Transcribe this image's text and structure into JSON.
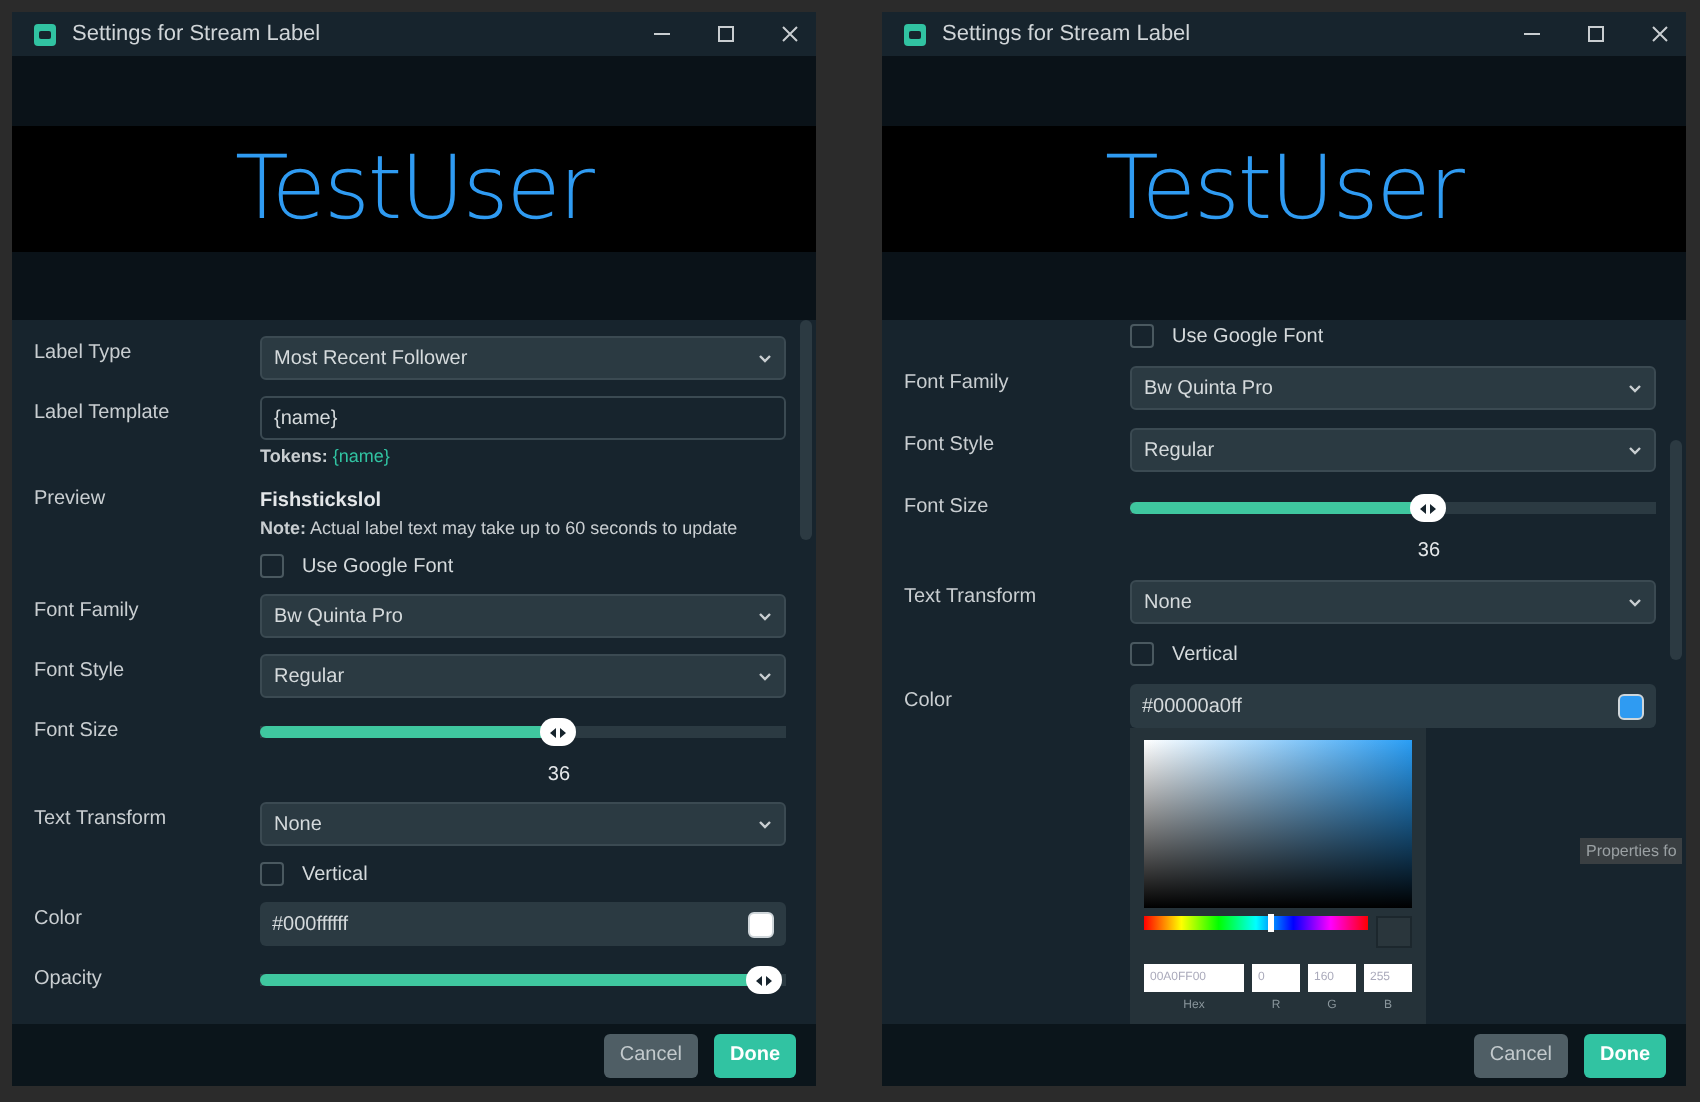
{
  "windows": [
    {
      "title": "Settings for Stream Label",
      "preview_text": "TestUser",
      "fields": [
        {
          "kind": "select",
          "label": "Label Type",
          "value": "Most Recent Follower"
        },
        {
          "kind": "text_input",
          "label": "Label Template",
          "value": "{name}",
          "tokens_label": "Tokens:",
          "token": "{name}"
        },
        {
          "kind": "preview",
          "label": "Preview",
          "value": "Fishstickslol",
          "note": "**Note:** Actual label text may take up to 60 seconds to update"
        },
        {
          "kind": "checkbox",
          "text": "Use Google Font",
          "checked": false
        },
        {
          "kind": "select",
          "label": "Font Family",
          "value": "Bw Quinta Pro"
        },
        {
          "kind": "select",
          "label": "Font Style",
          "value": "Regular"
        },
        {
          "kind": "slider",
          "label": "Font Size",
          "level": 0.57,
          "reading": "36"
        },
        {
          "kind": "select",
          "label": "Text Transform",
          "value": "None"
        },
        {
          "kind": "checkbox",
          "text": "Vertical",
          "checked": false
        },
        {
          "kind": "color",
          "label": "Color",
          "value": "#000ffffff",
          "color": "#ffffff"
        },
        {
          "kind": "slider",
          "label": "Opacity",
          "level": 0.99
        }
      ],
      "buttons": [
        {
          "kind": "secondary",
          "label": "Cancel"
        },
        {
          "kind": "primary",
          "label": "Done"
        }
      ]
    },
    {
      "title": "Settings for Stream Label",
      "preview_text": "TestUser",
      "fields": [
        {
          "kind": "checkbox",
          "text": "Use Google Font",
          "checked": false
        },
        {
          "kind": "select",
          "label": "Font Family",
          "value": "Bw Quinta Pro"
        },
        {
          "kind": "select",
          "label": "Font Style",
          "value": "Regular"
        },
        {
          "kind": "slider",
          "label": "Font Size",
          "level": 0.57,
          "reading": "36"
        },
        {
          "kind": "select",
          "label": "Text Transform",
          "value": "None"
        },
        {
          "kind": "checkbox",
          "text": "Vertical",
          "checked": false
        },
        {
          "kind": "color",
          "label": "Color",
          "value": "#00000a0ff",
          "color": "#2f9bf2",
          "picker": {
            "level": 0.56,
            "hex": "00A0FF00",
            "r": "0",
            "g": "160",
            "b": "255",
            "labels": [
              "Hex",
              "R",
              "G",
              "B"
            ]
          }
        }
      ],
      "buttons": [
        {
          "kind": "secondary",
          "label": "Cancel"
        },
        {
          "kind": "primary",
          "label": "Done"
        }
      ]
    }
  ],
  "tooltip": "Properties fo"
}
